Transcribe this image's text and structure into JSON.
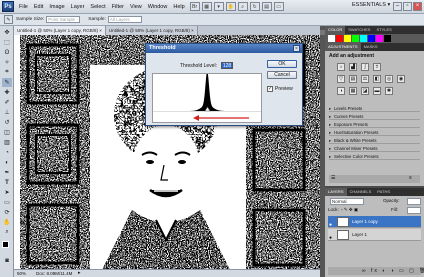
{
  "menubar": {
    "app_logo": "Ps",
    "items": [
      "File",
      "Edit",
      "Image",
      "Layer",
      "Select",
      "Filter",
      "View",
      "Window",
      "Help"
    ],
    "workspace": "ESSENTIALS ▾",
    "window_controls": {
      "minimize": "–",
      "restore": "▫",
      "close": "×"
    }
  },
  "options_bar": {
    "sample_size_label": "Sample Size:",
    "sample_size_value": "Point Sample",
    "sample_label": "Sample:",
    "sample_value": "All Layers"
  },
  "document": {
    "tabs": [
      "Untitled-1 @ 50% (Layer 1 copy, RGB/8) ×",
      "Untitled-1 @ 50% (Layer 1 copy, RGB/8) ×"
    ]
  },
  "status_bar": {
    "zoom": "50%",
    "doc": "Doc: 8.09M/11.4M"
  },
  "threshold_dialog": {
    "title": "Threshold",
    "level_label": "Threshold Level:",
    "level_value": "128",
    "ok_label": "OK",
    "cancel_label": "Cancel",
    "preview_label": "Preview",
    "preview_checked": "✓",
    "histogram_peak_level": 128,
    "arrow_color": "#d22020"
  },
  "panels": {
    "color_tabs": [
      "COLOR",
      "SWATCHES",
      "STYLES"
    ],
    "adjustments_tabs": [
      "ADJUSTMENTS",
      "MASKS"
    ],
    "adjustments_title": "Add an adjustment",
    "presets": [
      "Levels Presets",
      "Curves Presets",
      "Exposure Presets",
      "Hue/Saturation Presets",
      "Black & White Presets",
      "Channel Mixer Presets",
      "Selective Color Presets"
    ],
    "layers_tabs": [
      "LAYERS",
      "CHANNELS",
      "PATHS"
    ],
    "blend_mode": "Normal",
    "opacity_label": "Opacity:",
    "lock_label": "Lock:",
    "fill_label": "Fill:",
    "layers": [
      "Layer 1 copy",
      "Layer 1"
    ],
    "swatch_colors": [
      "#ffffff",
      "#ff0000",
      "#ffff00",
      "#00ff00",
      "#00ffff",
      "#0000ff",
      "#ff00ff",
      "#000000"
    ]
  }
}
